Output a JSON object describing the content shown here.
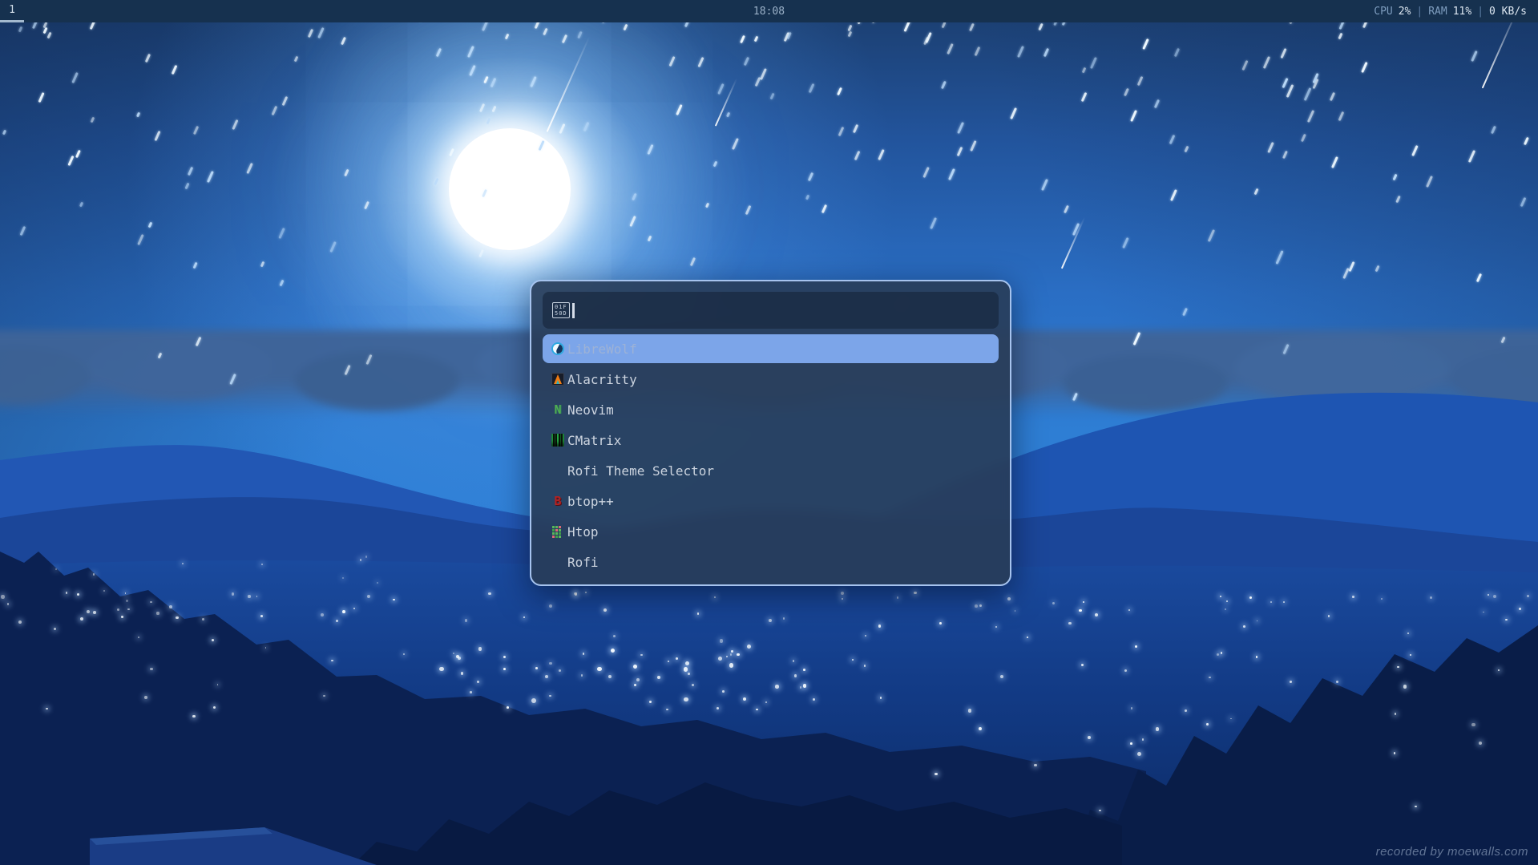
{
  "bar": {
    "workspace": "1",
    "clock": "18:08",
    "status": {
      "cpu_label": "CPU",
      "cpu_value": "2%",
      "ram_label": "RAM",
      "ram_value": "11%",
      "net_value": "0 KB/s",
      "separator": "|"
    }
  },
  "launcher": {
    "search": {
      "value": "",
      "placeholder": "",
      "missing_glyph_line1": "01F",
      "missing_glyph_line2": "50D"
    },
    "selected_index": 0,
    "items": [
      {
        "label": "LibreWolf",
        "icon": "librewolf-icon",
        "selected": true
      },
      {
        "label": "Alacritty",
        "icon": "alacritty-icon",
        "selected": false
      },
      {
        "label": "Neovim",
        "icon": "neovim-icon",
        "icon_glyph": "N",
        "selected": false
      },
      {
        "label": "CMatrix",
        "icon": "cmatrix-icon",
        "selected": false
      },
      {
        "label": "Rofi Theme Selector",
        "icon": null,
        "selected": false
      },
      {
        "label": "btop++",
        "icon": "btop-icon",
        "icon_glyph": "B",
        "selected": false
      },
      {
        "label": "Htop",
        "icon": "htop-icon",
        "selected": false
      },
      {
        "label": "Rofi",
        "icon": null,
        "selected": false
      }
    ]
  },
  "wallpaper": {
    "watermark": "recorded by moewalls.com",
    "scene": "night sky with full moon, meteor star shower, blue mountains, valley city lights, dark tree silhouettes"
  },
  "colors": {
    "bar_background": "#16314f",
    "bar_text": "#9fb6cf",
    "workspace_underline": "#a3b9ce",
    "launcher_border": "#a6c3ee",
    "launcher_background": "#283c58",
    "selection_background": "#7ca5e9",
    "selection_text": "#9db2d6",
    "item_text": "#ccd4df",
    "sky_bright": "#2e7ed4",
    "moon": "#ffffff"
  }
}
